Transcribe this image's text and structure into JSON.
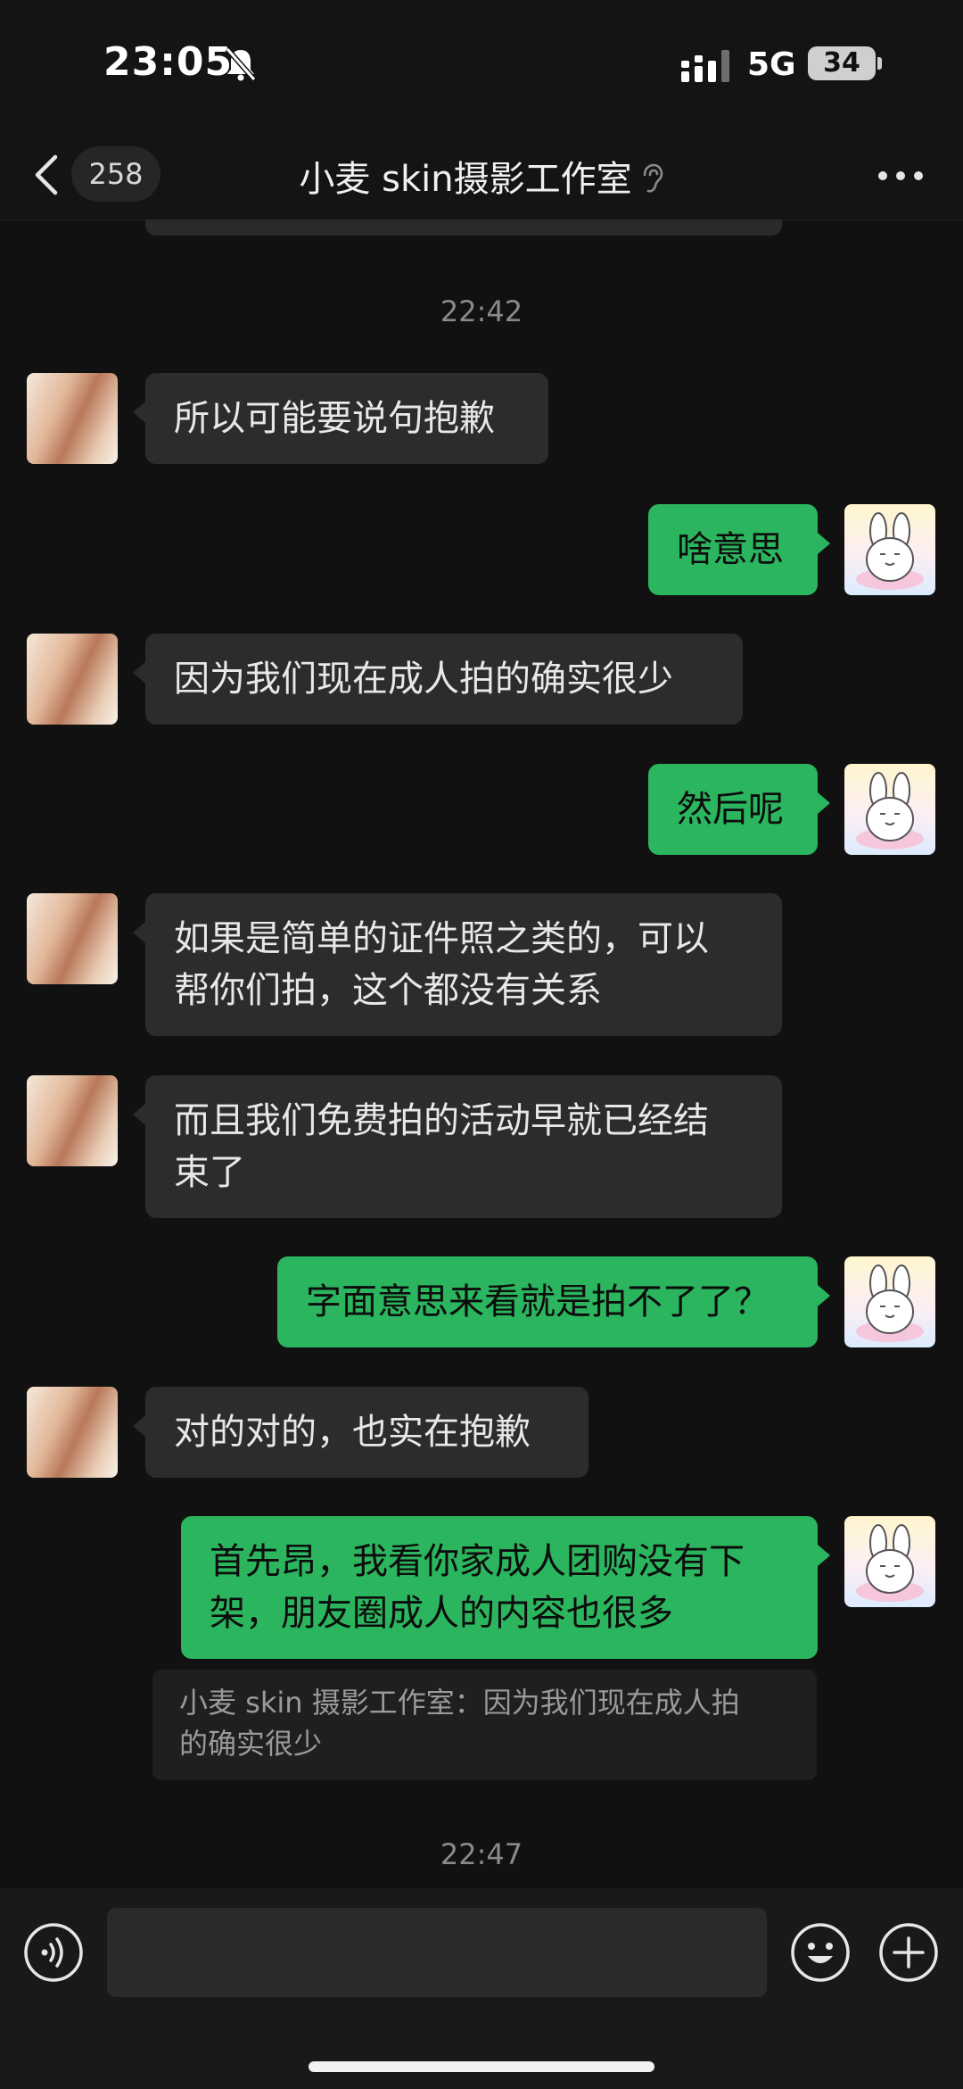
{
  "status_bar": {
    "time": "23:05",
    "network": "5G",
    "battery": "34"
  },
  "nav": {
    "unread_count": "258",
    "title": "小麦 skin摄影工作室"
  },
  "messages": [
    {
      "type": "timestamp",
      "text": "22:42"
    },
    {
      "type": "in",
      "text": "所以可能要说句抱歉"
    },
    {
      "type": "out",
      "text": "啥意思"
    },
    {
      "type": "in",
      "text": "因为我们现在成人拍的确实很少"
    },
    {
      "type": "out",
      "text": "然后呢"
    },
    {
      "type": "in",
      "lines": [
        "如果是简单的证件照之类的，可以",
        "帮你们拍，这个都没有关系"
      ]
    },
    {
      "type": "in",
      "lines": [
        "而且我们免费拍的活动早就已经结",
        "束了"
      ]
    },
    {
      "type": "out",
      "text": "字面意思来看就是拍不了了？"
    },
    {
      "type": "in",
      "text": "对的对的，也实在抱歉"
    },
    {
      "type": "out",
      "lines": [
        "首先昂，我看你家成人团购没有下",
        "架，朋友圈成人的内容也很多"
      ]
    },
    {
      "type": "quote",
      "lines": [
        "小麦 skin 摄影工作室：因为我们现在成人拍",
        "的确实很少"
      ]
    },
    {
      "type": "timestamp",
      "text": "22:47"
    }
  ],
  "icons": {
    "back": "chevron-left-icon",
    "mute": "bell-slash-icon",
    "ear": "ear-icon",
    "more": "more-dots-icon",
    "voice": "voice-icon",
    "emoji": "emoji-icon",
    "plus": "plus-icon"
  },
  "colors": {
    "background": "#111111",
    "incoming_bubble": "#2c2c2c",
    "outgoing_bubble": "#2bb55e",
    "timestamp": "#8a8a8a"
  }
}
